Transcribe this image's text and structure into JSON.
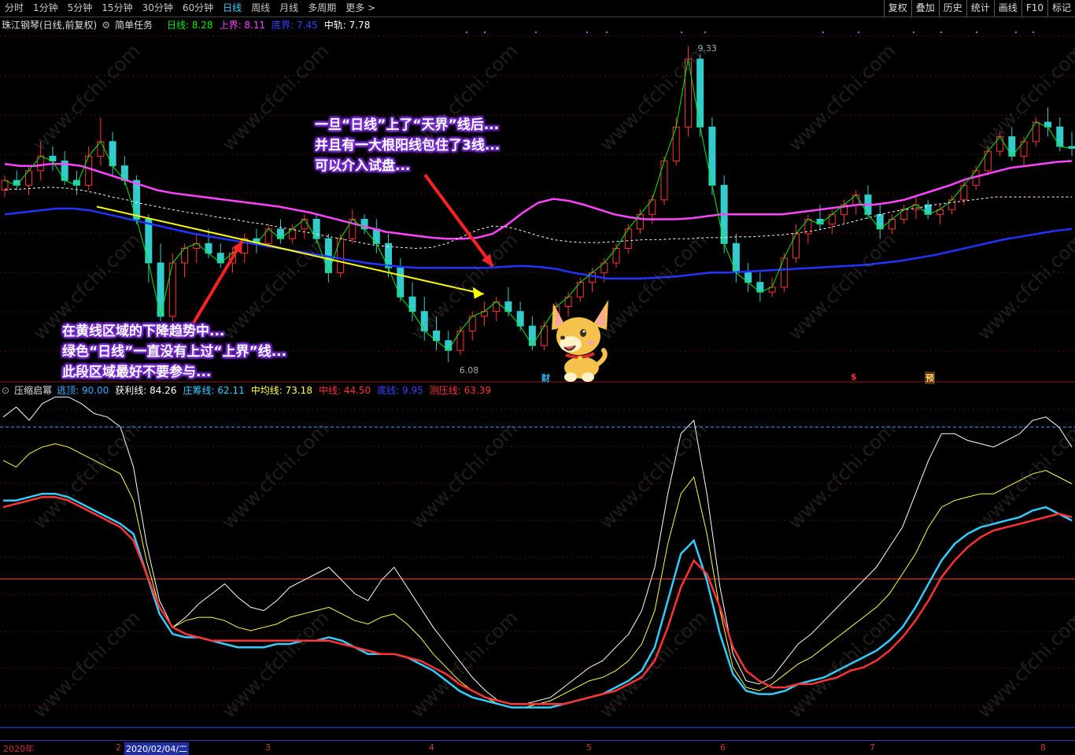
{
  "topbar": {
    "periods": [
      "分时",
      "1分钟",
      "5分钟",
      "15分钟",
      "30分钟",
      "60分钟",
      "日线",
      "周线",
      "月线",
      "多周期",
      "更多 >"
    ],
    "active_period": "日线",
    "tools": [
      "复权",
      "叠加",
      "历史",
      "统计",
      "画线",
      "F10",
      "标记"
    ]
  },
  "price_header": {
    "stock": "珠江钢琴(日线,前复权)",
    "task": "简单任务",
    "items": [
      {
        "label": "日线:",
        "value": "8.28",
        "color": "#00ee00"
      },
      {
        "label": "上界:",
        "value": "8.11",
        "color": "#ff44ff"
      },
      {
        "label": "底界:",
        "value": "7.45",
        "color": "#3344ff"
      },
      {
        "label": "中轨:",
        "value": "7.78",
        "color": "#ffffff"
      }
    ]
  },
  "indicator_header": {
    "name": "压缩启幂",
    "items": [
      {
        "label": "逃顶:",
        "value": "90.00",
        "color": "#33aaff"
      },
      {
        "label": "获利线:",
        "value": "84.26",
        "color": "#ffffff"
      },
      {
        "label": "庄筹线:",
        "value": "62.11",
        "color": "#33ccff"
      },
      {
        "label": "中均线:",
        "value": "73.18",
        "color": "#ffff44"
      },
      {
        "label": "中线:",
        "value": "44.50",
        "color": "#ff3333"
      },
      {
        "label": "底线:",
        "value": "9.95",
        "color": "#3344ff"
      },
      {
        "label": "测压线:",
        "value": "63.39",
        "color": "#ff3333"
      }
    ]
  },
  "annotations": {
    "price_high": "9.33",
    "price_low": "6.08",
    "callout_top": [
      "一旦“日线”上了“天界”线后...",
      "并且有一大根阳线包住了3线...",
      "可以介入试盘..."
    ],
    "callout_bottom": [
      "在黄线区域的下降趋势中...",
      "绿色“日线”一直没有上过“上界”线...",
      "此段区域最好不要参与..."
    ],
    "marker_cai": "财",
    "marker_s": "$",
    "marker_yu": "预"
  },
  "axis": {
    "year": "2020年",
    "selected_date": "2020/02/04/二",
    "months": [
      "2",
      "3",
      "4",
      "5",
      "6",
      "7",
      "8"
    ]
  },
  "watermark": "www.cfchi.com",
  "chart_data": [
    {
      "type": "candlestick",
      "title": "珠江钢琴(日线,前复权)",
      "ylim": [
        5.9,
        9.5
      ],
      "series": [
        {
          "name": "上界",
          "color": "#ff44ff"
        },
        {
          "name": "中轨",
          "color": "#ffffff"
        },
        {
          "name": "底界",
          "color": "#2233ff"
        },
        {
          "name": "日线",
          "color": "#00ee00"
        }
      ],
      "candles": [
        [
          7.85,
          8.0,
          7.78,
          7.95
        ],
        [
          7.95,
          8.05,
          7.85,
          7.9
        ],
        [
          7.9,
          8.1,
          7.8,
          8.05
        ],
        [
          8.05,
          8.35,
          7.95,
          8.2
        ],
        [
          8.2,
          8.3,
          8.05,
          8.15
        ],
        [
          8.15,
          8.25,
          7.9,
          7.95
        ],
        [
          7.95,
          8.05,
          7.8,
          7.9
        ],
        [
          7.9,
          8.3,
          7.85,
          8.2
        ],
        [
          8.2,
          8.6,
          8.1,
          8.35
        ],
        [
          8.35,
          8.45,
          8.0,
          8.1
        ],
        [
          8.1,
          8.2,
          7.9,
          7.95
        ],
        [
          7.95,
          8.0,
          7.5,
          7.55
        ],
        [
          7.55,
          7.6,
          6.9,
          7.1
        ],
        [
          7.1,
          7.3,
          6.5,
          6.55
        ],
        [
          6.55,
          7.2,
          6.5,
          7.1
        ],
        [
          7.1,
          7.3,
          6.95,
          7.25
        ],
        [
          7.25,
          7.4,
          7.1,
          7.3
        ],
        [
          7.3,
          7.45,
          7.15,
          7.2
        ],
        [
          7.2,
          7.3,
          7.05,
          7.1
        ],
        [
          7.1,
          7.25,
          7.0,
          7.2
        ],
        [
          7.2,
          7.4,
          7.1,
          7.35
        ],
        [
          7.35,
          7.45,
          7.2,
          7.3
        ],
        [
          7.3,
          7.5,
          7.25,
          7.45
        ],
        [
          7.45,
          7.55,
          7.3,
          7.35
        ],
        [
          7.35,
          7.5,
          7.3,
          7.45
        ],
        [
          7.45,
          7.6,
          7.35,
          7.55
        ],
        [
          7.55,
          7.6,
          7.3,
          7.35
        ],
        [
          7.35,
          7.4,
          6.9,
          7.0
        ],
        [
          7.0,
          7.4,
          6.95,
          7.35
        ],
        [
          7.35,
          7.65,
          7.3,
          7.55
        ],
        [
          7.55,
          7.6,
          7.4,
          7.45
        ],
        [
          7.45,
          7.55,
          7.2,
          7.3
        ],
        [
          7.3,
          7.4,
          6.95,
          7.05
        ],
        [
          7.05,
          7.15,
          6.7,
          6.75
        ],
        [
          6.75,
          6.9,
          6.5,
          6.6
        ],
        [
          6.6,
          6.75,
          6.3,
          6.4
        ],
        [
          6.4,
          6.55,
          6.2,
          6.3
        ],
        [
          6.3,
          6.4,
          6.08,
          6.2
        ],
        [
          6.2,
          6.45,
          6.15,
          6.4
        ],
        [
          6.4,
          6.6,
          6.3,
          6.55
        ],
        [
          6.55,
          6.7,
          6.45,
          6.6
        ],
        [
          6.6,
          6.75,
          6.5,
          6.7
        ],
        [
          6.7,
          6.85,
          6.55,
          6.6
        ],
        [
          6.6,
          6.7,
          6.4,
          6.45
        ],
        [
          6.45,
          6.55,
          6.2,
          6.25
        ],
        [
          6.25,
          6.5,
          6.2,
          6.45
        ],
        [
          6.45,
          6.7,
          6.4,
          6.65
        ],
        [
          6.65,
          6.8,
          6.55,
          6.75
        ],
        [
          6.75,
          6.95,
          6.7,
          6.9
        ],
        [
          6.9,
          7.05,
          6.8,
          7.0
        ],
        [
          7.0,
          7.15,
          6.9,
          7.1
        ],
        [
          7.1,
          7.3,
          7.05,
          7.25
        ],
        [
          7.25,
          7.5,
          7.2,
          7.45
        ],
        [
          7.45,
          7.65,
          7.4,
          7.6
        ],
        [
          7.6,
          7.8,
          7.5,
          7.75
        ],
        [
          7.75,
          8.2,
          7.7,
          8.15
        ],
        [
          8.15,
          8.6,
          8.1,
          8.5
        ],
        [
          8.5,
          9.33,
          8.4,
          9.2
        ],
        [
          9.2,
          9.25,
          8.4,
          8.5
        ],
        [
          8.5,
          8.6,
          7.8,
          7.9
        ],
        [
          7.9,
          8.0,
          7.2,
          7.3
        ],
        [
          7.3,
          7.4,
          6.9,
          7.0
        ],
        [
          7.0,
          7.1,
          6.8,
          6.9
        ],
        [
          6.9,
          7.0,
          6.7,
          6.8
        ],
        [
          6.8,
          6.95,
          6.75,
          6.85
        ],
        [
          6.85,
          7.2,
          6.8,
          7.15
        ],
        [
          7.15,
          7.5,
          7.1,
          7.4
        ],
        [
          7.4,
          7.6,
          7.3,
          7.55
        ],
        [
          7.55,
          7.7,
          7.45,
          7.5
        ],
        [
          7.5,
          7.65,
          7.4,
          7.6
        ],
        [
          7.6,
          7.75,
          7.5,
          7.7
        ],
        [
          7.7,
          7.85,
          7.6,
          7.8
        ],
        [
          7.8,
          7.9,
          7.55,
          7.6
        ],
        [
          7.6,
          7.7,
          7.35,
          7.45
        ],
        [
          7.45,
          7.6,
          7.4,
          7.55
        ],
        [
          7.55,
          7.7,
          7.5,
          7.65
        ],
        [
          7.65,
          7.8,
          7.55,
          7.7
        ],
        [
          7.7,
          7.75,
          7.55,
          7.6
        ],
        [
          7.6,
          7.7,
          7.5,
          7.65
        ],
        [
          7.65,
          7.8,
          7.6,
          7.75
        ],
        [
          7.75,
          7.95,
          7.7,
          7.9
        ],
        [
          7.9,
          8.1,
          7.85,
          8.05
        ],
        [
          8.05,
          8.3,
          8.0,
          8.25
        ],
        [
          8.25,
          8.45,
          8.2,
          8.4
        ],
        [
          8.4,
          8.5,
          8.15,
          8.2
        ],
        [
          8.2,
          8.4,
          8.1,
          8.35
        ],
        [
          8.35,
          8.6,
          8.3,
          8.55
        ],
        [
          8.55,
          8.7,
          8.4,
          8.5
        ],
        [
          8.5,
          8.6,
          8.25,
          8.3
        ],
        [
          8.3,
          8.45,
          8.2,
          8.28
        ]
      ],
      "upper": [
        8.12,
        8.1,
        8.1,
        8.12,
        8.12,
        8.1,
        8.05,
        8.0,
        7.95,
        7.9,
        7.85,
        7.82,
        7.8,
        7.78,
        7.76,
        7.74,
        7.72,
        7.7,
        7.68,
        7.65,
        7.62,
        7.58,
        7.54,
        7.5,
        7.46,
        7.42,
        7.4,
        7.38,
        7.36,
        7.35,
        7.35,
        7.36,
        7.4,
        7.5,
        7.62,
        7.72,
        7.76,
        7.74,
        7.7,
        7.65,
        7.6,
        7.57,
        7.55,
        7.55,
        7.55,
        7.56,
        7.58,
        7.6,
        7.6,
        7.6,
        7.6,
        7.6,
        7.62,
        7.64,
        7.66,
        7.68,
        7.7,
        7.7,
        7.72,
        7.75,
        7.8,
        7.85,
        7.9,
        7.96,
        8.0,
        8.04,
        8.08,
        8.1,
        8.12,
        8.14,
        8.15
      ],
      "mid": [
        7.86,
        7.86,
        7.87,
        7.88,
        7.87,
        7.85,
        7.82,
        7.78,
        7.75,
        7.71,
        7.68,
        7.65,
        7.62,
        7.6,
        7.57,
        7.55,
        7.52,
        7.5,
        7.47,
        7.44,
        7.41,
        7.38,
        7.35,
        7.32,
        7.29,
        7.27,
        7.26,
        7.25,
        7.26,
        7.3,
        7.37,
        7.44,
        7.48,
        7.47,
        7.43,
        7.38,
        7.34,
        7.32,
        7.31,
        7.31,
        7.32,
        7.33,
        7.34,
        7.34,
        7.35,
        7.35,
        7.36,
        7.36,
        7.37,
        7.37,
        7.38,
        7.39,
        7.41,
        7.43,
        7.46,
        7.5,
        7.54,
        7.58,
        7.62,
        7.65,
        7.67,
        7.7,
        7.72,
        7.74,
        7.76,
        7.78,
        7.78,
        7.78,
        7.78,
        7.78,
        7.78
      ],
      "lower": [
        7.6,
        7.62,
        7.64,
        7.66,
        7.66,
        7.64,
        7.6,
        7.56,
        7.52,
        7.48,
        7.44,
        7.4,
        7.37,
        7.34,
        7.31,
        7.28,
        7.25,
        7.22,
        7.19,
        7.16,
        7.13,
        7.1,
        7.08,
        7.06,
        7.05,
        7.05,
        7.05,
        7.05,
        7.05,
        7.06,
        7.07,
        7.06,
        7.04,
        7.0,
        6.97,
        6.94,
        6.94,
        6.94,
        6.95,
        6.96,
        6.98,
        7.0,
        7.0,
        7.01,
        7.02,
        7.03,
        7.04,
        7.05,
        7.06,
        7.07,
        7.08,
        7.1,
        7.12,
        7.15,
        7.18,
        7.22,
        7.26,
        7.3,
        7.34,
        7.37,
        7.4,
        7.43,
        7.45
      ],
      "trend_line": [
        [
          0.09,
          7.68
        ],
        [
          0.45,
          6.78
        ]
      ],
      "month_labels": [
        "2",
        "3",
        "4",
        "5",
        "6",
        "7",
        "8"
      ]
    },
    {
      "type": "line",
      "title": "压缩启幂",
      "ylim": [
        0,
        100
      ],
      "series": [
        {
          "name": "获利线",
          "color": "#ffffff",
          "values": [
            93,
            96,
            92,
            97,
            99,
            99,
            97,
            94,
            93,
            90,
            78,
            55,
            38,
            30,
            33,
            37,
            40,
            43,
            39,
            36,
            35,
            38,
            42,
            44,
            46,
            48,
            44,
            40,
            38,
            44,
            48,
            42,
            36,
            30,
            25,
            20,
            15,
            11,
            8,
            7,
            7,
            8,
            9,
            12,
            15,
            18,
            20,
            24,
            28,
            35,
            48,
            70,
            88,
            92,
            70,
            42,
            22,
            14,
            13,
            15,
            20,
            25,
            28,
            32,
            36,
            40,
            44,
            48,
            54,
            60,
            70,
            80,
            88,
            88,
            86,
            85,
            84,
            86,
            88,
            92,
            93,
            90,
            84
          ]
        },
        {
          "name": "中均线",
          "color": "#ffff44",
          "values": [
            80,
            78,
            82,
            84,
            85,
            84,
            82,
            80,
            78,
            76,
            68,
            50,
            36,
            30,
            32,
            33,
            33,
            32,
            30,
            29,
            30,
            31,
            33,
            34,
            35,
            36,
            34,
            32,
            31,
            33,
            34,
            31,
            27,
            22,
            18,
            14,
            11,
            9,
            7,
            6,
            6,
            7,
            8,
            10,
            12,
            14,
            15,
            17,
            20,
            25,
            35,
            55,
            70,
            75,
            58,
            35,
            18,
            12,
            11,
            13,
            16,
            19,
            21,
            24,
            27,
            30,
            33,
            36,
            40,
            46,
            52,
            60,
            66,
            68,
            69,
            70,
            70,
            72,
            74,
            76,
            77,
            75,
            73
          ]
        },
        {
          "name": "庄筹线",
          "color": "#33ccff",
          "values": [
            68,
            68,
            69,
            70,
            70,
            69,
            67,
            65,
            63,
            61,
            58,
            46,
            34,
            28,
            27,
            27,
            26,
            25,
            24,
            24,
            24,
            25,
            25,
            26,
            26,
            27,
            26,
            24,
            22,
            22,
            22,
            21,
            19,
            17,
            14,
            11,
            9,
            8,
            7,
            6,
            6,
            6,
            6,
            7,
            8,
            9,
            10,
            12,
            14,
            17,
            24,
            38,
            52,
            56,
            44,
            28,
            16,
            11,
            10,
            10,
            11,
            13,
            14,
            15,
            17,
            19,
            21,
            23,
            26,
            30,
            36,
            43,
            50,
            55,
            58,
            60,
            61,
            62,
            63,
            65,
            66,
            64,
            62
          ]
        },
        {
          "name": "测压线",
          "color": "#ff3333",
          "values": [
            66,
            67,
            68,
            69,
            69,
            68,
            66,
            64,
            62,
            60,
            56,
            46,
            36,
            30,
            28,
            27,
            26,
            26,
            26,
            26,
            26,
            26,
            26,
            26,
            26,
            26,
            25,
            24,
            23,
            22,
            22,
            21,
            20,
            18,
            16,
            13,
            11,
            9,
            8,
            7,
            7,
            7,
            7,
            7,
            8,
            9,
            10,
            11,
            13,
            15,
            20,
            30,
            42,
            50,
            46,
            36,
            24,
            17,
            14,
            12,
            12,
            13,
            13,
            14,
            15,
            17,
            18,
            20,
            23,
            27,
            32,
            38,
            45,
            50,
            54,
            57,
            59,
            60,
            61,
            62,
            63,
            64,
            63
          ]
        }
      ],
      "hlines": [
        {
          "value": 90,
          "color": "#3399ff",
          "dash": true
        },
        {
          "value": 44.5,
          "color": "#ff3333"
        },
        {
          "value": 0,
          "color": "#3344ff"
        }
      ]
    }
  ]
}
